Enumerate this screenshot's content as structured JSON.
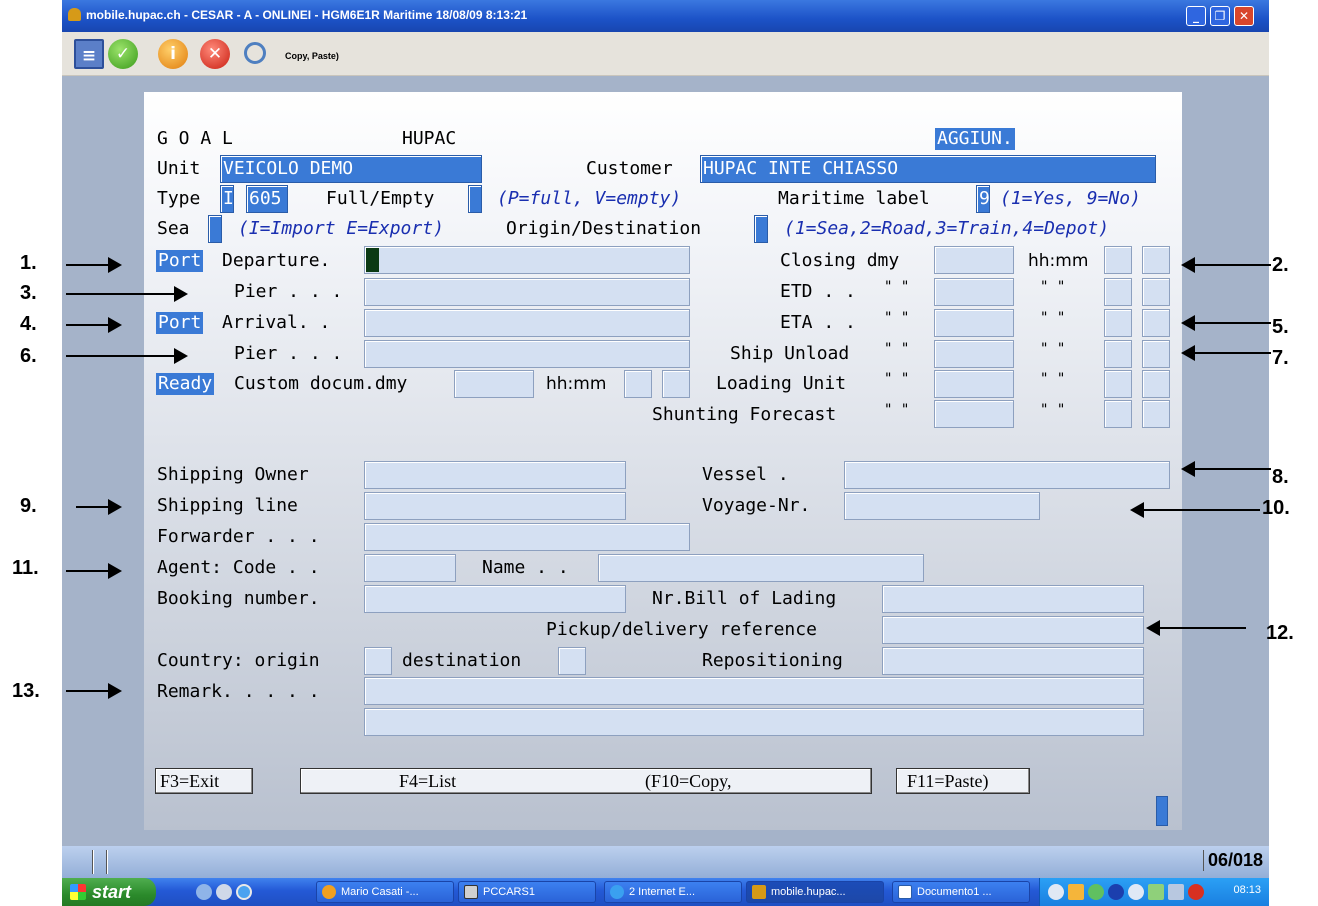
{
  "window": {
    "title": "mobile.hupac.ch - CESAR - A - ONLINEI - HGM6E1R    Maritime 18/08/09 8:13:21",
    "controls": [
      "_",
      "❐",
      "✕"
    ]
  },
  "toolbar": {
    "text": "Copy,  Paste)"
  },
  "header": {
    "goal": "G O A L",
    "company": "HUPAC",
    "mode": "AGGIUN."
  },
  "form": {
    "unit_label": "Unit",
    "unit_value": "VEICOLO DEMO",
    "customer_label": "Customer",
    "customer_value": "HUPAC INTE CHIASSO",
    "type_label": "Type",
    "type_code": "I",
    "type_num": "605",
    "fullempty_label": "Full/Empty",
    "fullempty_hint": "(P=full, V=empty)",
    "maritime_label": "Maritime label",
    "maritime_value": "9",
    "maritime_hint": "(1=Yes,  9=No)",
    "sea_label": "Sea",
    "sea_hint": "(I=Import  E=Export)",
    "origdest_label": "Origin/Destination",
    "origdest_hint": "(1=Sea,2=Road,3=Train,4=Depot)",
    "port_tag": "Port",
    "departure_label": "Departure.",
    "pier_label": "Pier . . .",
    "arrival_label": "Arrival. .",
    "ready_tag": "Ready",
    "custom_label": "Custom docum.dmy",
    "hhmm": "hh:mm",
    "closing_label": "Closing dmy",
    "etd_label": "ETD . .",
    "eta_label": "ETA . .",
    "shipunload_label": "Ship Unload",
    "loadingunit_label": "Loading Unit",
    "shunting_label": "Shunting Forecast",
    "ditto": "\" \"",
    "shipowner_label": "Shipping Owner",
    "shipline_label": "Shipping line",
    "forwarder_label": "Forwarder . . .",
    "agent_label": "Agent: Code . .",
    "name_label": "Name . .",
    "booking_label": "Booking number.",
    "vessel_label": "Vessel .",
    "voyage_label": "Voyage-Nr.",
    "bill_label": "Nr.Bill of Lading",
    "pickup_label": "Pickup/delivery reference",
    "country_label": "Country: origin",
    "destination_label": "destination",
    "repositioning_label": "Repositioning",
    "remark_label": "Remark. . . . ."
  },
  "fkeys": {
    "f3": "F3=Exit",
    "f4": "F4=List",
    "f10": "(F10=Copy,",
    "f11": "F11=Paste)"
  },
  "annotations": [
    "1.",
    "2.",
    "3.",
    "4.",
    "5.",
    "6.",
    "7.",
    "8.",
    "9.",
    "10.",
    "11.",
    "12.",
    "13."
  ],
  "status": {
    "page": "06/018"
  },
  "taskbar": {
    "start": "start",
    "tasks": [
      "Mario Casati -...",
      "PCCARS1",
      "2 Internet E...",
      "mobile.hupac...",
      "Documento1 ..."
    ],
    "clock": "08:13"
  }
}
